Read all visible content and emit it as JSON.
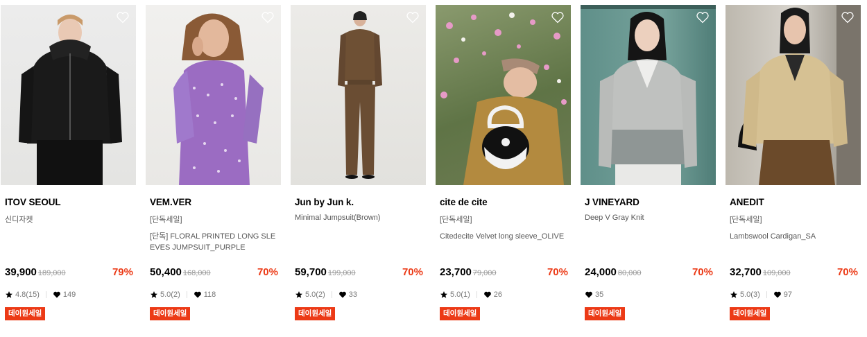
{
  "products": [
    {
      "brand": "ITOV SEOUL",
      "line1": "신디자켓",
      "line2": "",
      "price": "39,900",
      "original_price": "189,000",
      "discount": "79%",
      "rating": "4.8(15)",
      "likes": "149",
      "badge": "데이원세일",
      "image_alt": "model in black knit hooded jacket"
    },
    {
      "brand": "VEM.VER",
      "line1": "[단독세일]",
      "line2": "[단독] FLORAL PRINTED LONG SLEEVES JUMPSUIT_PURPLE",
      "price": "50,400",
      "original_price": "168,000",
      "discount": "70%",
      "rating": "5.0(2)",
      "likes": "118",
      "badge": "데이원세일",
      "image_alt": "model in purple floral printed jumpsuit"
    },
    {
      "brand": "Jun by Jun k.",
      "line1": "Minimal Jumpsuit(Brown)",
      "line2": "",
      "price": "59,700",
      "original_price": "199,000",
      "discount": "70%",
      "rating": "5.0(2)",
      "likes": "33",
      "badge": "데이원세일",
      "image_alt": "model in brown minimal jumpsuit"
    },
    {
      "brand": "cite de cite",
      "line1": "[단독세일]",
      "line2": "Citedecite Velvet long sleeve_OLIVE",
      "price": "23,700",
      "original_price": "79,000",
      "discount": "70%",
      "rating": "5.0(1)",
      "likes": "26",
      "badge": "데이원세일",
      "image_alt": "model with black bag among cosmos flowers"
    },
    {
      "brand": "J VINEYARD",
      "line1": "Deep V Gray Knit",
      "line2": "",
      "price": "24,000",
      "original_price": "80,000",
      "discount": "70%",
      "rating": "",
      "likes": "35",
      "badge": "데이원세일",
      "image_alt": "model in gray deep v knit"
    },
    {
      "brand": "ANEDIT",
      "line1": "[단독세일]",
      "line2": "Lambswool Cardigan_SA",
      "price": "32,700",
      "original_price": "109,000",
      "discount": "70%",
      "rating": "5.0(3)",
      "likes": "97",
      "badge": "데이원세일",
      "image_alt": "model in beige lambswool cardigan"
    }
  ],
  "colors": {
    "discount": "#ec3a16",
    "badge_bg": "#ec3a16",
    "muted": "#999999"
  },
  "icons": {
    "wishlist": "heart-outline-icon",
    "rating": "star-icon",
    "likes": "heart-filled-icon"
  }
}
